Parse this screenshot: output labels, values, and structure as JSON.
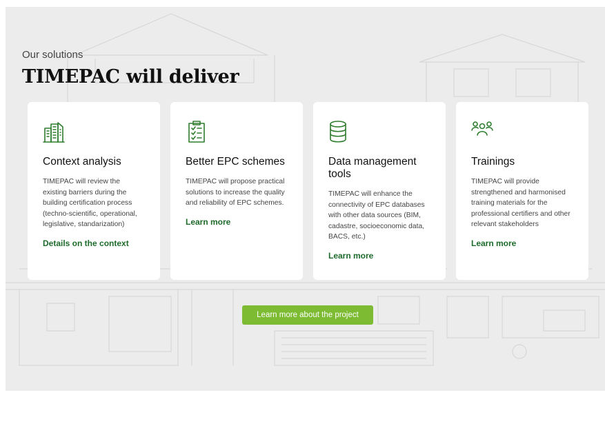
{
  "hero": {
    "eyebrow": "Our solutions",
    "headline": "TIMEPAC will deliver"
  },
  "cards": [
    {
      "icon": "building-icon",
      "title": "Context analysis",
      "body": "TIMEPAC will review the existing barriers during the building certification process (techno-scientific, operational, legislative, standarization)",
      "link": "Details on the context"
    },
    {
      "icon": "clipboard-checklist-icon",
      "title": "Better EPC schemes",
      "body": "TIMEPAC will propose practical solutions to increase the quality and reliability of EPC schemes.",
      "link": "Learn more"
    },
    {
      "icon": "database-icon",
      "title": "Data management tools",
      "body": "TIMEPAC will enhance the connectivity of EPC databases with other data sources (BIM, cadastre, socioeconomic data, BACS, etc.)",
      "link": "Learn more"
    },
    {
      "icon": "people-group-icon",
      "title": "Trainings",
      "body": "TIMEPAC will provide strengthened and harmonised training materials for the professional certifiers and other relevant stakeholders",
      "link": "Learn more"
    }
  ],
  "cta": {
    "label": "Learn more about the project"
  },
  "colors": {
    "accent_green": "#2f7d2f",
    "cta_green": "#7dbb33",
    "link_green": "#1e6b2c",
    "section_bg": "#ececec"
  }
}
